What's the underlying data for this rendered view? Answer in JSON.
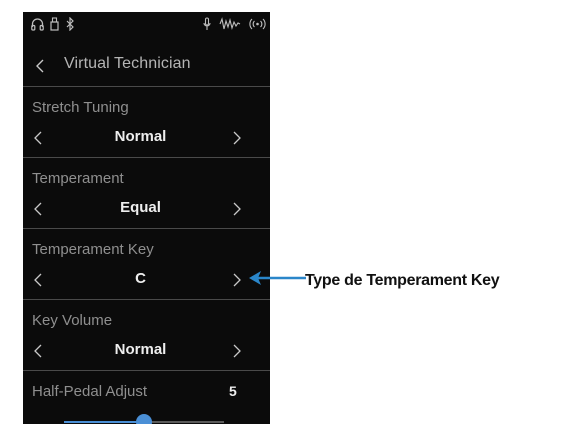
{
  "status_bar": {
    "icons": [
      "headphones-icon",
      "usb-icon",
      "bluetooth-icon",
      "microphone-icon",
      "audio-waveform-icon",
      "wireless-icon"
    ]
  },
  "header": {
    "title": "Virtual Technician",
    "back_icon": "chevron-left-icon"
  },
  "settings": [
    {
      "label": "Stretch Tuning",
      "value": "Normal"
    },
    {
      "label": "Temperament",
      "value": "Equal"
    },
    {
      "label": "Temperament Key",
      "value": "C"
    },
    {
      "label": "Key Volume",
      "value": "Normal"
    }
  ],
  "half_pedal": {
    "label": "Half-Pedal Adjust",
    "value": "5",
    "level_fraction": 0.5
  },
  "callout": {
    "text": "Type de Temperament Key",
    "color": "#2a86c9"
  },
  "colors": {
    "screen_bg": "#0b0b0b",
    "accent": "#4a8fd6"
  }
}
